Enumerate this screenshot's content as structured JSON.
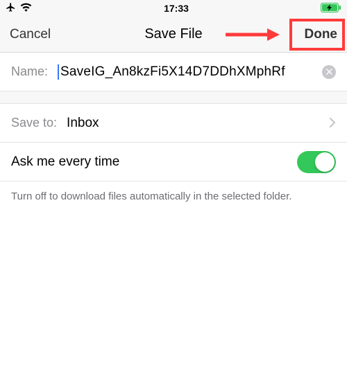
{
  "status": {
    "time": "17:33"
  },
  "nav": {
    "cancel": "Cancel",
    "title": "Save File",
    "done": "Done"
  },
  "name_row": {
    "label": "Name:",
    "value": "SaveIG_An8kzFi5X14D7DDhXMphRf"
  },
  "save_to_row": {
    "label": "Save to:",
    "value": "Inbox"
  },
  "ask_row": {
    "label": "Ask me every time",
    "on": true
  },
  "helper_text": "Turn off to download files automatically in the selected folder."
}
